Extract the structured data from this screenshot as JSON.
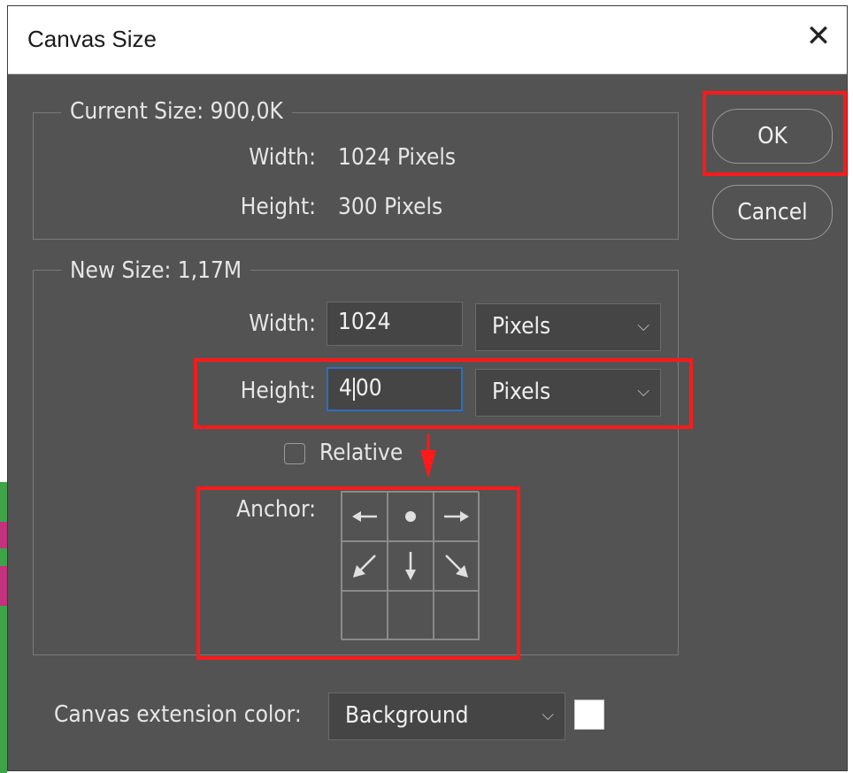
{
  "dialog": {
    "title": "Canvas Size",
    "close_glyph": "✕"
  },
  "current_size": {
    "legend": "Current Size: 900,0K",
    "width_label": "Width:",
    "width_value": "1024 Pixels",
    "height_label": "Height:",
    "height_value": "300 Pixels"
  },
  "new_size": {
    "legend": "New Size: 1,17M",
    "width_label": "Width:",
    "width_value": "1024",
    "width_unit": "Pixels",
    "height_label": "Height:",
    "height_value_before_caret": "4",
    "height_value_after_caret": "00",
    "height_unit": "Pixels",
    "relative_label": "Relative",
    "relative_checked": false,
    "anchor_label": "Anchor:"
  },
  "anchor": {
    "cells": [
      "arrow-left-icon",
      "dot-icon",
      "arrow-right-icon",
      "arrow-down-left-icon",
      "arrow-down-icon",
      "arrow-down-right-icon",
      "",
      "",
      ""
    ]
  },
  "extension": {
    "label": "Canvas extension color:",
    "value": "Background",
    "swatch_color": "#ffffff"
  },
  "buttons": {
    "ok": "OK",
    "cancel": "Cancel"
  },
  "annotation_color": "#ff1a1a"
}
